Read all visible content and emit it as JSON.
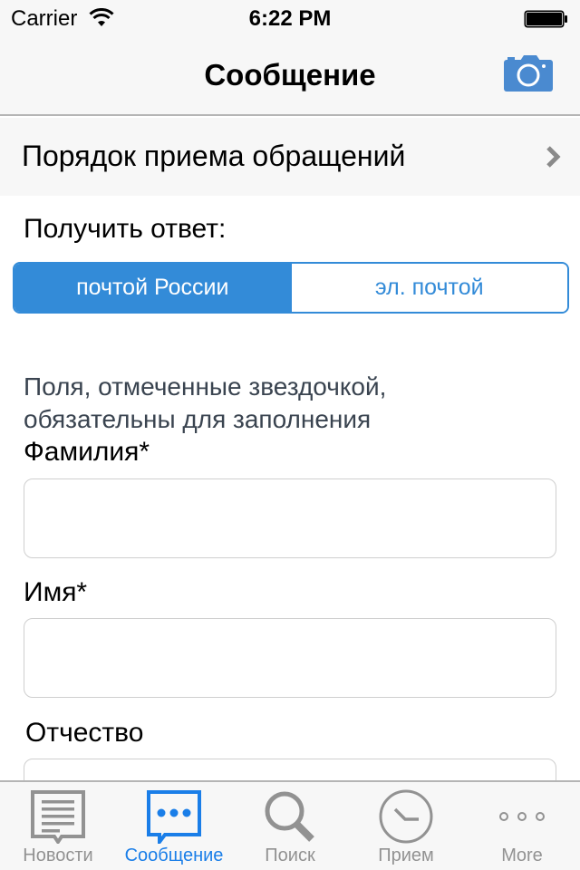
{
  "status_bar": {
    "carrier": "Carrier",
    "time": "6:22 PM",
    "wifi_icon": "wifi-icon",
    "battery_icon": "battery-full-icon"
  },
  "nav_bar": {
    "title": "Сообщение",
    "right_button_icon": "camera-icon"
  },
  "procedure_row": {
    "label": "Порядок приема обращений",
    "icon": "chevron-right-icon"
  },
  "reply": {
    "label": "Получить ответ:",
    "options": [
      {
        "label": "почтой России",
        "selected": true
      },
      {
        "label": "эл. почтой",
        "selected": false
      }
    ]
  },
  "form": {
    "hint": "Поля, отмеченные звездочкой, обязательны для заполнения",
    "fields": [
      {
        "label": "Фамилия*",
        "value": ""
      },
      {
        "label": "Имя*",
        "value": ""
      },
      {
        "label": "Отчество",
        "value": ""
      }
    ]
  },
  "tab_bar": {
    "tabs": [
      {
        "label": "Новости",
        "icon": "news-icon",
        "active": false
      },
      {
        "label": "Сообщение",
        "icon": "message-icon",
        "active": true
      },
      {
        "label": "Поиск",
        "icon": "search-icon",
        "active": false
      },
      {
        "label": "Прием",
        "icon": "clock-icon",
        "active": false
      },
      {
        "label": "More",
        "icon": "more-icon",
        "active": false
      }
    ]
  },
  "colors": {
    "accent": "#338bd8",
    "tab_active": "#1a7ee8",
    "tab_inactive": "#929292",
    "bar_background": "#f7f7f7"
  }
}
